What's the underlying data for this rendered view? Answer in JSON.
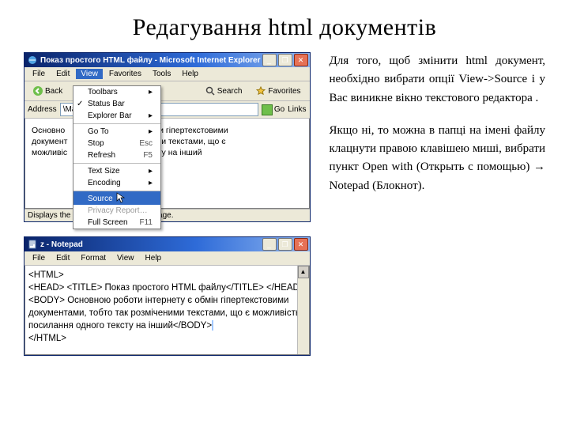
{
  "heading": "Редагування html документів",
  "paragraphs": [
    "Для того, щоб змінити html документ, необхідно вибрати опції View->Source і у Вас виникне вікно текстового редактора .",
    "Якщо ні, то можна в папці на імені файлу клацнути правою клавішею миші, вибрати пункт Open with (Открыть с помощью) → Notepad (Блокнот)."
  ],
  "ie": {
    "title": "Показ простого HTML файлу - Microsoft Internet Explorer",
    "menu": [
      "File",
      "Edit",
      "View",
      "Favorites",
      "Tools",
      "Help"
    ],
    "open_index": 2,
    "tool_back": "Back",
    "tool_search": "Search",
    "tool_fav": "Favorites",
    "addr_label": "Address",
    "addr_value": "\\Malenovata\\z.html",
    "go": "Go",
    "links": "Links",
    "bg1": "Основно",
    "bg2": "документ",
    "bg3": "можливіс",
    "bg1b": "обми гіпертекстовими",
    "bg2b": "еними текстами, що є",
    "bg3b": "тексту на інший",
    "dropdown": [
      {
        "label": "Toolbars",
        "sub": true
      },
      {
        "label": "Status Bar",
        "check": true
      },
      {
        "label": "Explorer Bar",
        "sub": true
      },
      {
        "label": "Go To",
        "sub": true,
        "sep": true
      },
      {
        "label": "Stop",
        "hint": "Esc"
      },
      {
        "label": "Refresh",
        "hint": "F5"
      },
      {
        "label": "Text Size",
        "sub": true,
        "sep": true
      },
      {
        "label": "Encoding",
        "sub": true
      },
      {
        "label": "Source",
        "sep": true,
        "hl": true
      },
      {
        "label": "Privacy Report…",
        "dim": true
      },
      {
        "label": "Full Screen",
        "hint": "F11"
      }
    ],
    "status": "Displays the source (HTML) for this page."
  },
  "np": {
    "title": "z - Notepad",
    "menu": [
      "File",
      "Edit",
      "Format",
      "View",
      "Help"
    ],
    "lines": [
      "<HTML>",
      "<HEAD> <TITLE> Показ простого HTML файлу</TITLE> </HEAD>",
      "<BODY> Основною роботи інтернету є обмін гіпертекстовими",
      "документами, тобто так розміченими текстами, що є можливість",
      "посилання одного тексту на інший</BODY>",
      "</HTML>"
    ]
  }
}
